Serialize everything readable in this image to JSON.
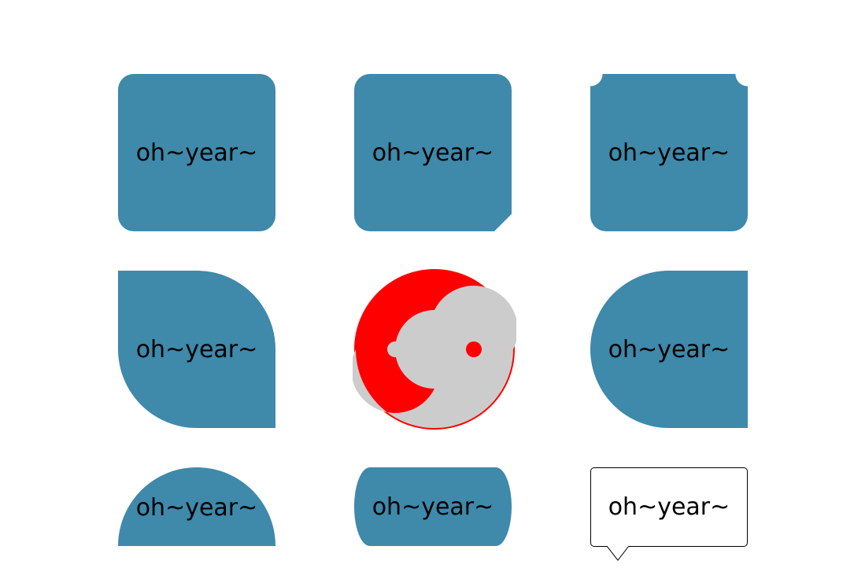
{
  "shapes": [
    {
      "label": "oh~year~",
      "kind": "rounded-rectangle"
    },
    {
      "label": "oh~year~",
      "kind": "rounded-rectangle-cut-corner"
    },
    {
      "label": "oh~year~",
      "kind": "inverted-top-corners"
    },
    {
      "label": "oh~year~",
      "kind": "leaf"
    },
    {
      "label": "",
      "kind": "yin-yang"
    },
    {
      "label": "oh~year~",
      "kind": "left-half-round"
    },
    {
      "label": "oh~year~",
      "kind": "semicircle"
    },
    {
      "label": "oh~year~",
      "kind": "capsule"
    },
    {
      "label": "oh~year~",
      "kind": "speech-bubble"
    }
  ],
  "colors": {
    "shape_fill": "#3f89aa",
    "yin_yang_primary": "#ff0000",
    "yin_yang_secondary": "#cccccc",
    "background": "#ffffff",
    "text": "#000000"
  }
}
